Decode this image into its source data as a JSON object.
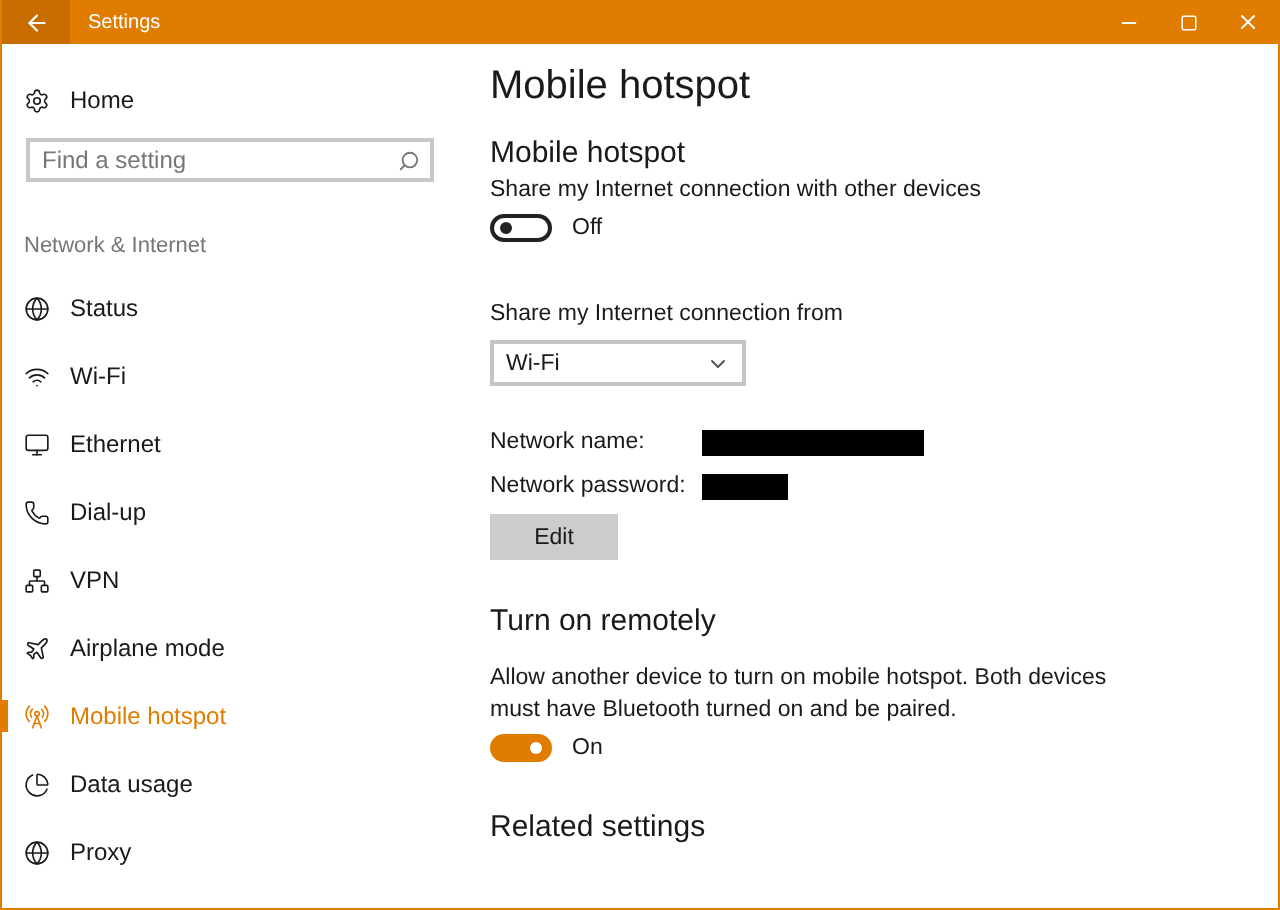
{
  "window": {
    "title": "Settings"
  },
  "sidebar": {
    "home": "Home",
    "search": {
      "placeholder": "Find a setting"
    },
    "section": "Network & Internet",
    "items": [
      {
        "kind": "status",
        "label": "Status",
        "selected": false
      },
      {
        "kind": "wifi",
        "label": "Wi-Fi",
        "selected": false
      },
      {
        "kind": "ethernet",
        "label": "Ethernet",
        "selected": false
      },
      {
        "kind": "dialup",
        "label": "Dial-up",
        "selected": false
      },
      {
        "kind": "vpn",
        "label": "VPN",
        "selected": false
      },
      {
        "kind": "airplane",
        "label": "Airplane mode",
        "selected": false
      },
      {
        "kind": "hotspot",
        "label": "Mobile hotspot",
        "selected": true
      },
      {
        "kind": "data",
        "label": "Data usage",
        "selected": false
      },
      {
        "kind": "proxy",
        "label": "Proxy",
        "selected": false
      }
    ]
  },
  "main": {
    "title": "Mobile hotspot",
    "hotspot": {
      "heading": "Mobile hotspot",
      "description": "Share my Internet connection with other devices",
      "toggle": {
        "on": false,
        "label": "Off"
      }
    },
    "share_from": {
      "label": "Share my Internet connection from",
      "value": "Wi-Fi"
    },
    "fields": [
      {
        "label": "Network name:"
      },
      {
        "label": "Network password:"
      }
    ],
    "edit_button": "Edit",
    "remote": {
      "heading": "Turn on remotely",
      "description": "Allow another device to turn on mobile hotspot. Both devices must have Bluetooth turned on and be paired.",
      "toggle": {
        "on": true,
        "label": "On"
      }
    },
    "related_heading": "Related settings"
  }
}
